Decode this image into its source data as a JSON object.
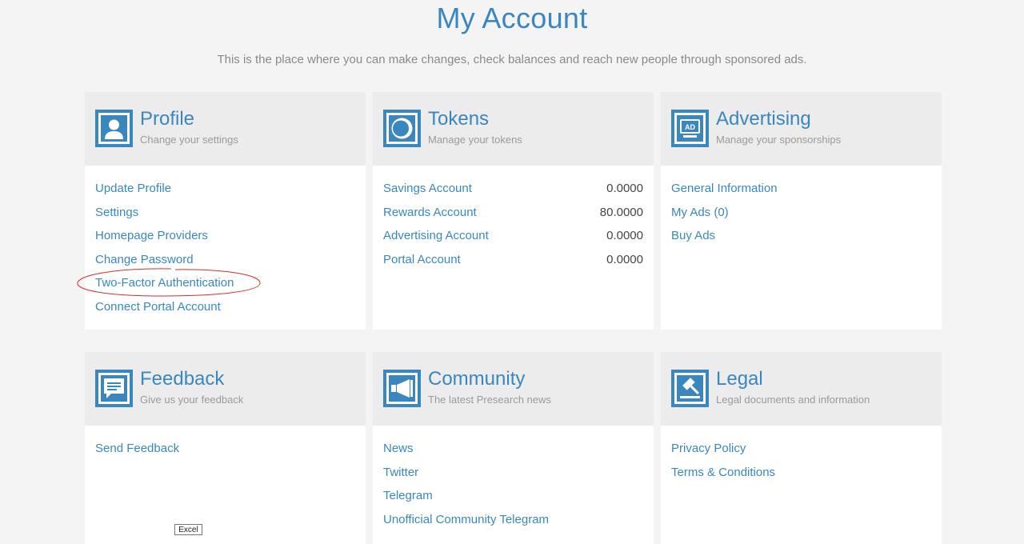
{
  "page": {
    "title": "My Account",
    "subtitle": "This is the place where you can make changes, check balances and reach new people through sponsored ads."
  },
  "cards": {
    "profile": {
      "title": "Profile",
      "subtitle": "Change your settings",
      "icon": "user-profile-icon",
      "links": [
        "Update Profile",
        "Settings",
        "Homepage Providers",
        "Change Password",
        "Two-Factor Authentication",
        "Connect Portal Account"
      ]
    },
    "tokens": {
      "title": "Tokens",
      "subtitle": "Manage your tokens",
      "icon": "token-coin-icon",
      "rows": [
        {
          "label": "Savings Account",
          "value": "0.0000"
        },
        {
          "label": "Rewards Account",
          "value": "80.0000"
        },
        {
          "label": "Advertising Account",
          "value": "0.0000"
        },
        {
          "label": "Portal Account",
          "value": "0.0000"
        }
      ]
    },
    "advertising": {
      "title": "Advertising",
      "subtitle": "Manage your sponsorships",
      "icon": "ad-monitor-icon",
      "icon_text": "AD",
      "links": [
        "General Information",
        "My Ads (0)",
        "Buy Ads"
      ]
    },
    "feedback": {
      "title": "Feedback",
      "subtitle": "Give us your feedback",
      "icon": "speech-bubble-icon",
      "links": [
        "Send Feedback"
      ]
    },
    "community": {
      "title": "Community",
      "subtitle": "The latest Presearch news",
      "icon": "megaphone-icon",
      "links": [
        "News",
        "Twitter",
        "Telegram",
        "Unofficial Community Telegram"
      ]
    },
    "legal": {
      "title": "Legal",
      "subtitle": "Legal documents and information",
      "icon": "gavel-icon",
      "links": [
        "Privacy Policy",
        "Terms & Conditions"
      ]
    }
  },
  "tooltip": {
    "text": "Excel"
  },
  "colors": {
    "accent": "#3a87bf",
    "annotation": "#d32f2f",
    "header_bg": "#ececec",
    "page_bg": "#f4f4f4"
  }
}
